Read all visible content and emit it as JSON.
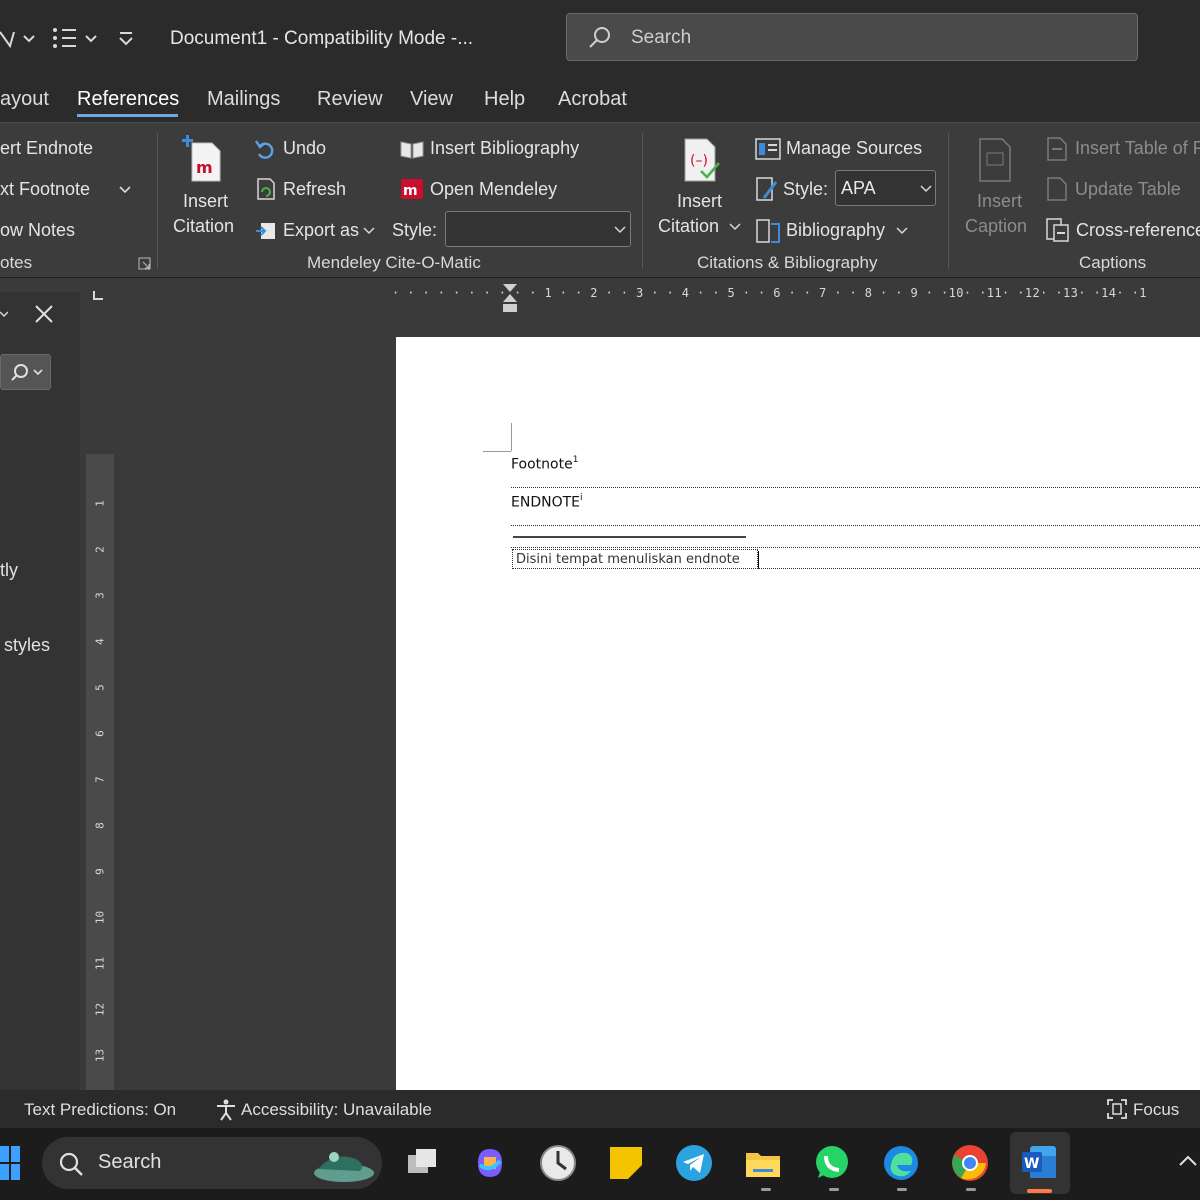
{
  "titlebar": {
    "document_title": "Document1  -  Compatibility Mode  -...",
    "search_placeholder": "Search"
  },
  "tabs": [
    {
      "label": "ayout"
    },
    {
      "label": "References"
    },
    {
      "label": "Mailings"
    },
    {
      "label": "Review"
    },
    {
      "label": "View"
    },
    {
      "label": "Help"
    },
    {
      "label": "Acrobat"
    }
  ],
  "ribbon": {
    "footnotes": {
      "insert_endnote": "ert Endnote",
      "next_footnote": "xt Footnote",
      "show_notes": "ow Notes",
      "group_label": "otes"
    },
    "mendeley": {
      "insert_citation_line1": "Insert",
      "insert_citation_line2": "Citation",
      "undo": "Undo",
      "refresh": "Refresh",
      "export_as": "Export as",
      "insert_bibliography": "Insert Bibliography",
      "open_mendeley": "Open Mendeley",
      "style_label": "Style:",
      "style_value": "",
      "group_label": "Mendeley Cite-O-Matic"
    },
    "citations": {
      "insert_citation_line1": "Insert",
      "insert_citation_line2": "Citation",
      "manage_sources": "Manage Sources",
      "style_label": "Style:",
      "style_value": "APA",
      "bibliography": "Bibliography",
      "group_label": "Citations & Bibliography"
    },
    "captions": {
      "insert_caption_line1": "Insert",
      "insert_caption_line2": "Caption",
      "insert_table_of_figures": "Insert Table of F",
      "update_table": "Update Table",
      "cross_reference": "Cross-reference",
      "group_label": "Captions"
    }
  },
  "ruler": {
    "horizontal": "· · · · · · · ·    · · 1 · · 2 · · 3 · · 4 · · 5 · · 6 · · 7 · · 8 · · 9 · ·10· ·11· ·12· ·13· ·14· ·1",
    "vertical_numbers": [
      "1",
      "2",
      "3",
      "4",
      "5",
      "6",
      "7",
      "8",
      "9",
      "10",
      "11",
      "12",
      "13"
    ]
  },
  "navpane": {
    "partial_text_1": "tly",
    "partial_text_2": "styles"
  },
  "document": {
    "line1": "Footnote",
    "line1_sup": "1",
    "line2": "ENDNOTE",
    "line2_sup": "i",
    "endnote_text": "Disini tempat menuliskan endnote"
  },
  "statusbar": {
    "text_predictions": "Text Predictions: On",
    "accessibility": "Accessibility: Unavailable",
    "focus": "Focus"
  },
  "taskbar": {
    "search_label": "Search"
  },
  "colors": {
    "accent_tab_underline": "#6fa8dc",
    "mendeley_red": "#c8102e",
    "word_blue": "#185abd"
  }
}
